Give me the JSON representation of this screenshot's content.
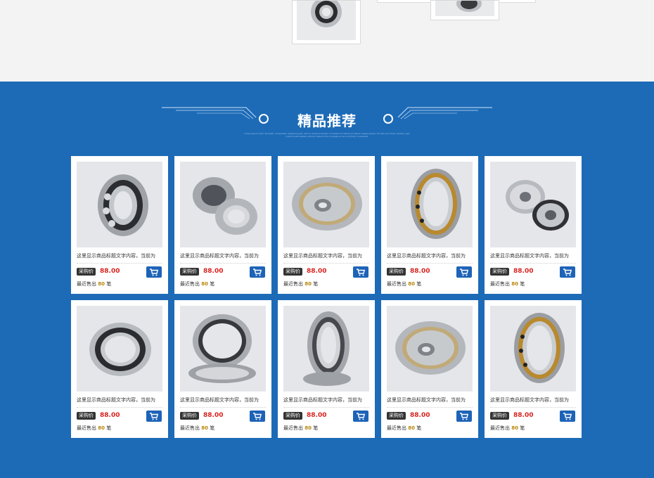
{
  "section": {
    "title": "精品推荐",
    "subtitle": "Lorem ipsum dolor sit amet, consectetur adipiscing elit, sed do eiusmod tempor incididunt ut labore et dolore magna aliqua. Ut enim ad minim veniam, quis nostrud exercitation ullamco laboris nisi ut aliquip ex ea commodo consequat."
  },
  "colors": {
    "background_blue": "#1d6bb7",
    "price_red": "#d9231f",
    "cart_blue": "#1d63b7"
  },
  "products": [
    {
      "name": "这里显示商品标题文字内容，当前为",
      "tag": "采购价",
      "price": "88.00",
      "sold_prefix": "最近售出",
      "sold_count": "80",
      "sold_suffix": "笔"
    },
    {
      "name": "这里显示商品标题文字内容，当前为",
      "tag": "采购价",
      "price": "88.00",
      "sold_prefix": "最近售出",
      "sold_count": "80",
      "sold_suffix": "笔"
    },
    {
      "name": "这里显示商品标题文字内容，当前为",
      "tag": "采购价",
      "price": "88.00",
      "sold_prefix": "最近售出",
      "sold_count": "80",
      "sold_suffix": "笔"
    },
    {
      "name": "这里显示商品标题文字内容，当前为",
      "tag": "采购价",
      "price": "88.00",
      "sold_prefix": "最近售出",
      "sold_count": "80",
      "sold_suffix": "笔"
    },
    {
      "name": "这里显示商品标题文字内容，当前为",
      "tag": "采购价",
      "price": "88.00",
      "sold_prefix": "最近售出",
      "sold_count": "80",
      "sold_suffix": "笔"
    },
    {
      "name": "这里显示商品标题文字内容，当前为",
      "tag": "采购价",
      "price": "88.00",
      "sold_prefix": "最近售出",
      "sold_count": "80",
      "sold_suffix": "笔"
    },
    {
      "name": "这里显示商品标题文字内容，当前为",
      "tag": "采购价",
      "price": "88.00",
      "sold_prefix": "最近售出",
      "sold_count": "80",
      "sold_suffix": "笔"
    },
    {
      "name": "这里显示商品标题文字内容，当前为",
      "tag": "采购价",
      "price": "88.00",
      "sold_prefix": "最近售出",
      "sold_count": "80",
      "sold_suffix": "笔"
    },
    {
      "name": "这里显示商品标题文字内容，当前为",
      "tag": "采购价",
      "price": "88.00",
      "sold_prefix": "最近售出",
      "sold_count": "80",
      "sold_suffix": "笔"
    },
    {
      "name": "这里显示商品标题文字内容，当前为",
      "tag": "采购价",
      "price": "88.00",
      "sold_prefix": "最近售出",
      "sold_count": "80",
      "sold_suffix": "笔"
    }
  ]
}
